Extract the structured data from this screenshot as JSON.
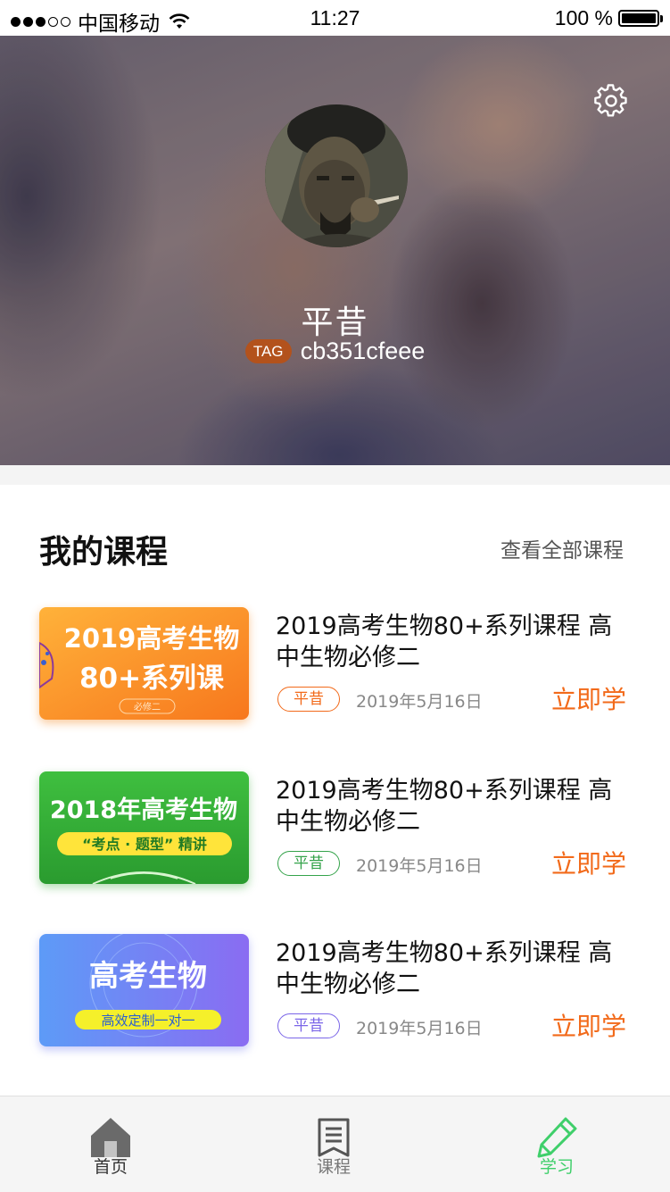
{
  "status_bar": {
    "carrier": "中国移动",
    "time": "11:27",
    "battery": "100 %",
    "signal_bars_filled": 3,
    "signal_bars_total": 5
  },
  "profile": {
    "name": "平昔",
    "tag_label": "TAG",
    "tag_value": "cb351cfeee"
  },
  "courses_section": {
    "title": "我的课程",
    "view_all": "查看全部课程"
  },
  "courses": [
    {
      "thumb_line1": "2019高考生物",
      "thumb_line2": "80+系列课",
      "thumb_line3": "必修二",
      "title": "2019高考生物80+系列课程 高中生物必修二",
      "teacher": "平昔",
      "date": "2019年5月16日",
      "action": "立即学",
      "tag_color": "#f26a1a"
    },
    {
      "thumb_line1": "2018年高考生物",
      "thumb_line2": "“考点 · 题型” 精讲",
      "title": "2019高考生物80+系列课程 高中生物必修二",
      "teacher": "平昔",
      "date": "2019年5月16日",
      "action": "立即学",
      "tag_color": "#34a34a"
    },
    {
      "thumb_line1": "高考生物",
      "thumb_line2": "高效定制一对一",
      "title": "2019高考生物80+系列课程 高中生物必修二",
      "teacher": "平昔",
      "date": "2019年5月16日",
      "action": "立即学",
      "tag_color": "#7b66e8"
    }
  ],
  "tab_bar": {
    "home": "首页",
    "courses": "课程",
    "study": "学习",
    "active_tab": "study",
    "active_color": "#3fcf6a"
  },
  "icons": {
    "settings": "gear-icon",
    "home": "home-icon",
    "courses": "book-icon",
    "study": "pencil-icon",
    "wifi": "wifi-icon",
    "battery": "battery-icon"
  }
}
